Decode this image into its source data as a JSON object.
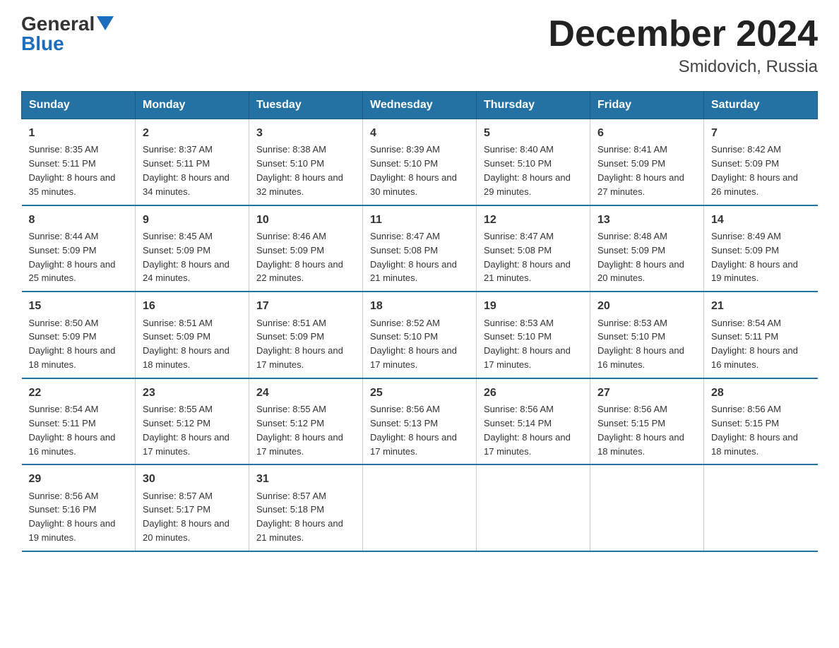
{
  "header": {
    "logo_general": "General",
    "logo_blue": "Blue",
    "month_title": "December 2024",
    "location": "Smidovich, Russia"
  },
  "weekdays": [
    "Sunday",
    "Monday",
    "Tuesday",
    "Wednesday",
    "Thursday",
    "Friday",
    "Saturday"
  ],
  "weeks": [
    [
      {
        "day": "1",
        "sunrise": "8:35 AM",
        "sunset": "5:11 PM",
        "daylight": "8 hours and 35 minutes."
      },
      {
        "day": "2",
        "sunrise": "8:37 AM",
        "sunset": "5:11 PM",
        "daylight": "8 hours and 34 minutes."
      },
      {
        "day": "3",
        "sunrise": "8:38 AM",
        "sunset": "5:10 PM",
        "daylight": "8 hours and 32 minutes."
      },
      {
        "day": "4",
        "sunrise": "8:39 AM",
        "sunset": "5:10 PM",
        "daylight": "8 hours and 30 minutes."
      },
      {
        "day": "5",
        "sunrise": "8:40 AM",
        "sunset": "5:10 PM",
        "daylight": "8 hours and 29 minutes."
      },
      {
        "day": "6",
        "sunrise": "8:41 AM",
        "sunset": "5:09 PM",
        "daylight": "8 hours and 27 minutes."
      },
      {
        "day": "7",
        "sunrise": "8:42 AM",
        "sunset": "5:09 PM",
        "daylight": "8 hours and 26 minutes."
      }
    ],
    [
      {
        "day": "8",
        "sunrise": "8:44 AM",
        "sunset": "5:09 PM",
        "daylight": "8 hours and 25 minutes."
      },
      {
        "day": "9",
        "sunrise": "8:45 AM",
        "sunset": "5:09 PM",
        "daylight": "8 hours and 24 minutes."
      },
      {
        "day": "10",
        "sunrise": "8:46 AM",
        "sunset": "5:09 PM",
        "daylight": "8 hours and 22 minutes."
      },
      {
        "day": "11",
        "sunrise": "8:47 AM",
        "sunset": "5:08 PM",
        "daylight": "8 hours and 21 minutes."
      },
      {
        "day": "12",
        "sunrise": "8:47 AM",
        "sunset": "5:08 PM",
        "daylight": "8 hours and 21 minutes."
      },
      {
        "day": "13",
        "sunrise": "8:48 AM",
        "sunset": "5:09 PM",
        "daylight": "8 hours and 20 minutes."
      },
      {
        "day": "14",
        "sunrise": "8:49 AM",
        "sunset": "5:09 PM",
        "daylight": "8 hours and 19 minutes."
      }
    ],
    [
      {
        "day": "15",
        "sunrise": "8:50 AM",
        "sunset": "5:09 PM",
        "daylight": "8 hours and 18 minutes."
      },
      {
        "day": "16",
        "sunrise": "8:51 AM",
        "sunset": "5:09 PM",
        "daylight": "8 hours and 18 minutes."
      },
      {
        "day": "17",
        "sunrise": "8:51 AM",
        "sunset": "5:09 PM",
        "daylight": "8 hours and 17 minutes."
      },
      {
        "day": "18",
        "sunrise": "8:52 AM",
        "sunset": "5:10 PM",
        "daylight": "8 hours and 17 minutes."
      },
      {
        "day": "19",
        "sunrise": "8:53 AM",
        "sunset": "5:10 PM",
        "daylight": "8 hours and 17 minutes."
      },
      {
        "day": "20",
        "sunrise": "8:53 AM",
        "sunset": "5:10 PM",
        "daylight": "8 hours and 16 minutes."
      },
      {
        "day": "21",
        "sunrise": "8:54 AM",
        "sunset": "5:11 PM",
        "daylight": "8 hours and 16 minutes."
      }
    ],
    [
      {
        "day": "22",
        "sunrise": "8:54 AM",
        "sunset": "5:11 PM",
        "daylight": "8 hours and 16 minutes."
      },
      {
        "day": "23",
        "sunrise": "8:55 AM",
        "sunset": "5:12 PM",
        "daylight": "8 hours and 17 minutes."
      },
      {
        "day": "24",
        "sunrise": "8:55 AM",
        "sunset": "5:12 PM",
        "daylight": "8 hours and 17 minutes."
      },
      {
        "day": "25",
        "sunrise": "8:56 AM",
        "sunset": "5:13 PM",
        "daylight": "8 hours and 17 minutes."
      },
      {
        "day": "26",
        "sunrise": "8:56 AM",
        "sunset": "5:14 PM",
        "daylight": "8 hours and 17 minutes."
      },
      {
        "day": "27",
        "sunrise": "8:56 AM",
        "sunset": "5:15 PM",
        "daylight": "8 hours and 18 minutes."
      },
      {
        "day": "28",
        "sunrise": "8:56 AM",
        "sunset": "5:15 PM",
        "daylight": "8 hours and 18 minutes."
      }
    ],
    [
      {
        "day": "29",
        "sunrise": "8:56 AM",
        "sunset": "5:16 PM",
        "daylight": "8 hours and 19 minutes."
      },
      {
        "day": "30",
        "sunrise": "8:57 AM",
        "sunset": "5:17 PM",
        "daylight": "8 hours and 20 minutes."
      },
      {
        "day": "31",
        "sunrise": "8:57 AM",
        "sunset": "5:18 PM",
        "daylight": "8 hours and 21 minutes."
      },
      null,
      null,
      null,
      null
    ]
  ]
}
